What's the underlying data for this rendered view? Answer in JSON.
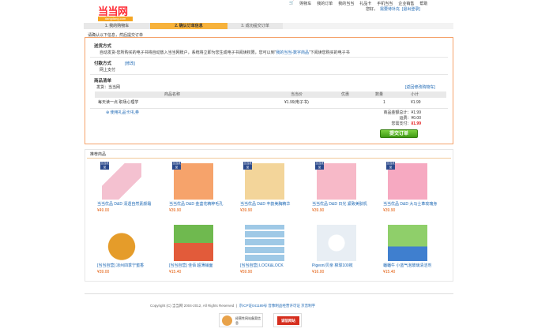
{
  "header": {
    "logo_text": "当当网",
    "logo_url": "dangdang.com",
    "nav": [
      "购物车",
      "我的订单",
      "我的当当",
      "礼品卡",
      "手机当当",
      "企业销售",
      "帮助"
    ],
    "welcome": "您好，",
    "username": "需要待补充",
    "logout": "[退出登录]"
  },
  "steps": [
    "1. 我的购物车",
    "2. 确认订单信息",
    "3. 成功提交订单"
  ],
  "hint": "请确认以下信息，然后提交订单",
  "delivery": {
    "title": "送货方式",
    "text": "自动发货-您所购买的电子书将自动放入当当网账户，系统将立即为您生成电子书阅读权限，您可以到“",
    "link": "我的当当-数字商品",
    "text_after": "”下阅读您购买的电子书"
  },
  "payment": {
    "title": "付款方式",
    "edit": "[修改]",
    "method": "网上支付"
  },
  "items": {
    "title": "商品清单",
    "seller": "发货：当当网",
    "back_link": "[返回修改购物车]",
    "columns": [
      "商品名称",
      "当当价",
      "优惠",
      "数量",
      "小计"
    ],
    "rows": [
      {
        "name": "每天读一点 职场心理学",
        "price": "¥1.99(电子书)",
        "discount": "",
        "qty": "1",
        "subtotal": "¥1.99"
      }
    ],
    "giftcard": "使用礼品卡/礼券"
  },
  "summary": {
    "goods_label": "商品金额总计：",
    "goods_value": "¥1.99",
    "shipping_label": "运费：",
    "shipping_value": "¥0.00",
    "total_label": "您需支付：",
    "total_value": "¥1.99",
    "submit": "提交订单"
  },
  "recommend": {
    "title": "推荐商品",
    "badge": "当当优品",
    "products": [
      {
        "name": "当当优品 D&D 清透自然素颜霜",
        "price": "¥49.00",
        "color": "#f4c1d0"
      },
      {
        "name": "当当优品 D&D 金盏花精粹毛孔",
        "price": "¥39.90",
        "color": "#f6a36b"
      },
      {
        "name": "当当优品 D&D 丰韵美胸精华",
        "price": "¥39.90",
        "color": "#f3d59a"
      },
      {
        "name": "当当优品 D&D 日光 紧致美肤机",
        "price": "¥39.90",
        "color": "#f7b9c8"
      },
      {
        "name": "当当优品 D&D 大马士革玫瑰身",
        "price": "¥39.90",
        "color": "#f6a9c1"
      },
      {
        "name": "[当当自营] 凉州四季宁蜜香",
        "price": "¥39.00",
        "color": "#e59c2a"
      },
      {
        "name": "[当当自营] 佳佰 超薄铺面",
        "price": "¥15.40",
        "color": "#6fb94f"
      },
      {
        "name": "[当当自营] LOCK&LOCK",
        "price": "¥59.90",
        "color": "#9fc9e6"
      },
      {
        "name": "Pigeon/贝亲 棉球100枚",
        "price": "¥16.00",
        "color": "#e8eef4"
      },
      {
        "name": "蟠蟠牛 小蓝气泡玻璃清洁剂",
        "price": "¥15.40",
        "color": "#8fcf6a"
      }
    ]
  },
  "footer": {
    "copyright": "Copyright (C) 当当网 2004-2012, All Rights Reserved",
    "icp": "京ICP证041189号 音像制品经营许可证 京音制字",
    "badge1": "经营性网站备案信息",
    "badge2": "诚信网站"
  }
}
